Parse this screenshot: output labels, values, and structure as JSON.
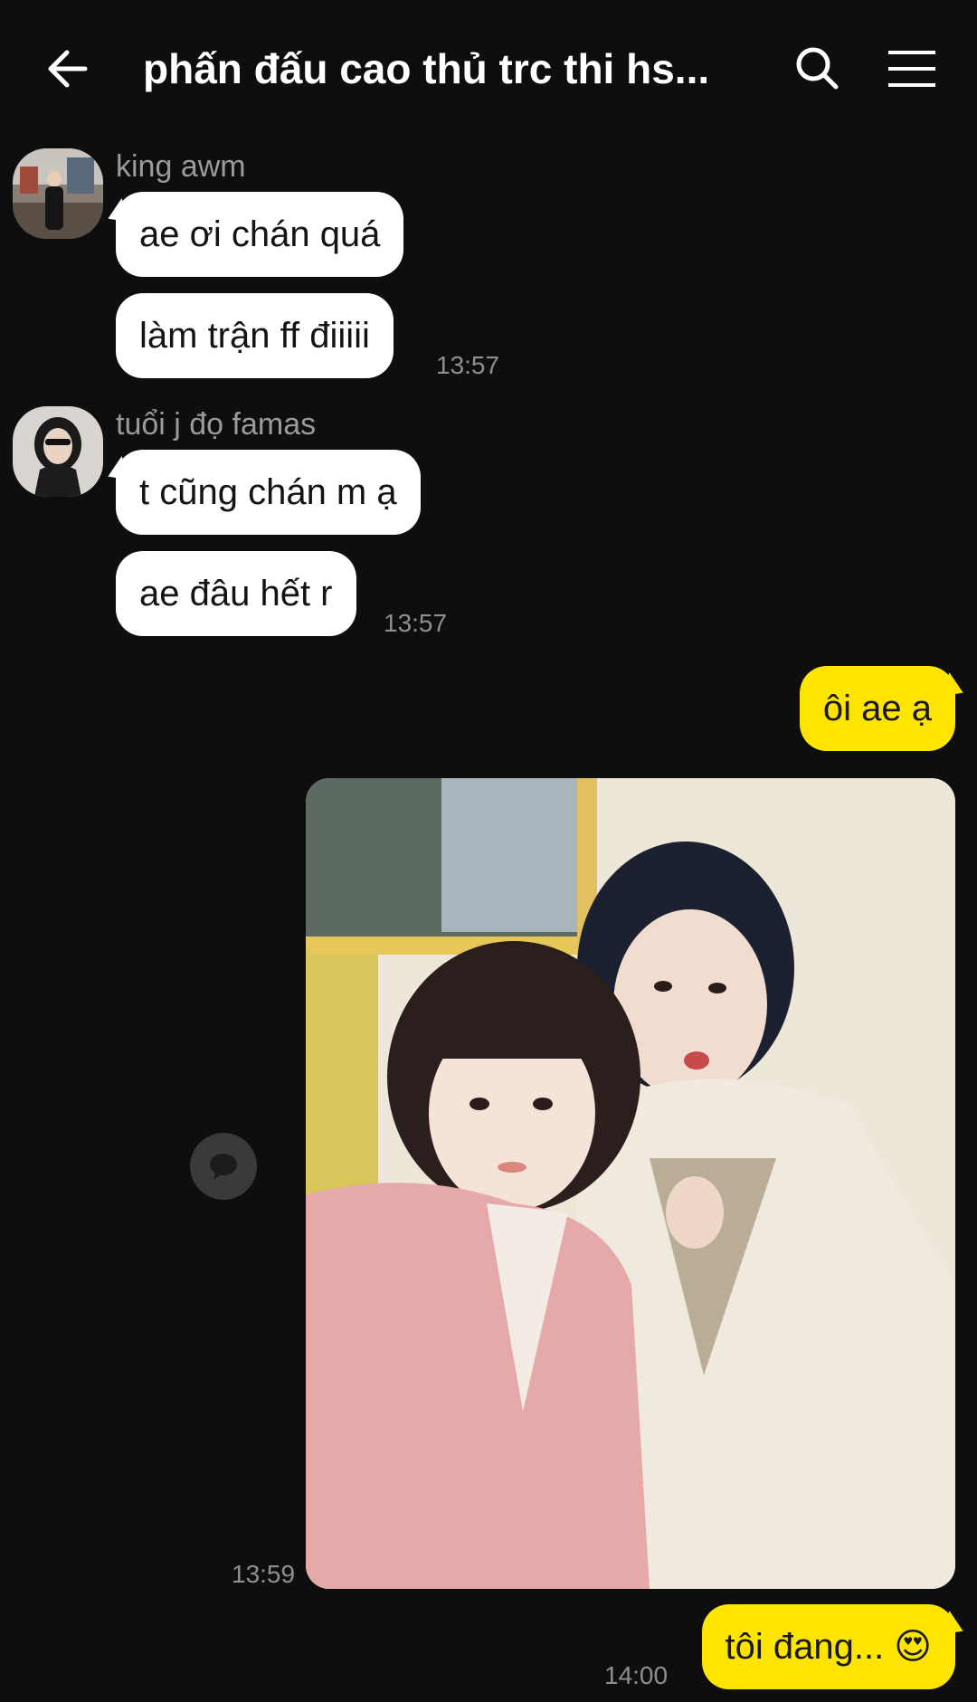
{
  "header": {
    "title": "phấn đấu cao thủ trc thi hs...",
    "back_icon": "arrow-left-icon",
    "search_icon": "search-icon",
    "menu_icon": "hamburger-menu-icon"
  },
  "messages": [
    {
      "sender": "king awm",
      "bubbles": [
        "ae ơi chán quá",
        "làm trận ff điiiii"
      ],
      "time": "13:57"
    },
    {
      "sender": "tuổi j đọ famas",
      "bubbles": [
        "t cũng chán m ạ",
        "ae đâu hết r"
      ],
      "time": "13:57"
    }
  ],
  "mine": {
    "text_1": "ôi ae ạ",
    "photo_time": "13:59",
    "text_2": "tôi đang... 😍",
    "time_2": "14:00"
  },
  "colors": {
    "background": "#0e0e0f",
    "my_bubble": "#fee500",
    "their_bubble": "#ffffff",
    "meta_text": "#8f8f93"
  }
}
